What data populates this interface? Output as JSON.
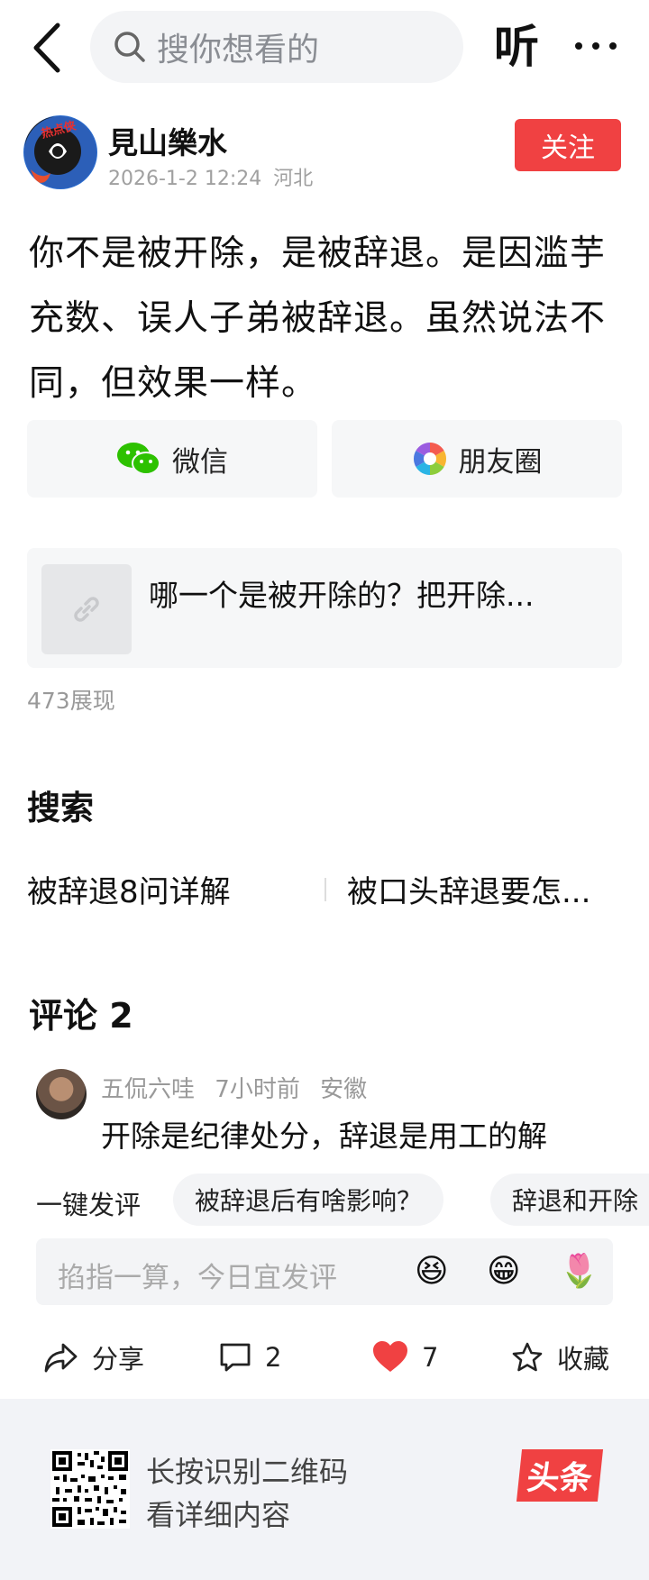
{
  "topbar": {
    "search_placeholder": "搜你想看的",
    "listen_label": "听"
  },
  "author": {
    "name": "見山樂水",
    "time": "2026-1-2 12:24",
    "location": "河北",
    "follow_label": "关注",
    "avatar_badge": "热点侠"
  },
  "post": {
    "text": "你不是被开除，是被辞退。是因滥芋充数、误人子弟被辞退。虽然说法不同，但效果一样。"
  },
  "share": {
    "wechat_label": "微信",
    "moments_label": "朋友圈"
  },
  "link_card": {
    "title": "哪一个是被开除的？把开除..."
  },
  "impressions": "473展现",
  "search_section": {
    "heading": "搜索",
    "items": [
      "被辞退8问详解",
      "被口头辞退要怎..."
    ]
  },
  "comments": {
    "heading": "评论 2",
    "items": [
      {
        "user": "五侃六哇",
        "time": "7小时前",
        "location": "安徽",
        "text": "开除是纪律处分，辞退是用工的解"
      }
    ]
  },
  "quick_comment": {
    "label": "一键发评",
    "chips": [
      "被辞退后有啥影响？",
      "辞退和开除"
    ]
  },
  "comment_input": {
    "placeholder": "掐指一算，今日宜发评",
    "emojis": [
      "😆",
      "😁",
      "🌷"
    ]
  },
  "actions": {
    "share_label": "分享",
    "comment_count": "2",
    "like_count": "7",
    "favorite_label": "收藏",
    "like_color": "#f04142"
  },
  "footer": {
    "line1": "长按识别二维码",
    "line2": "看详细内容",
    "logo_text": "头条"
  },
  "colors": {
    "accent": "#f04142",
    "wechat_green": "#2dc100"
  }
}
